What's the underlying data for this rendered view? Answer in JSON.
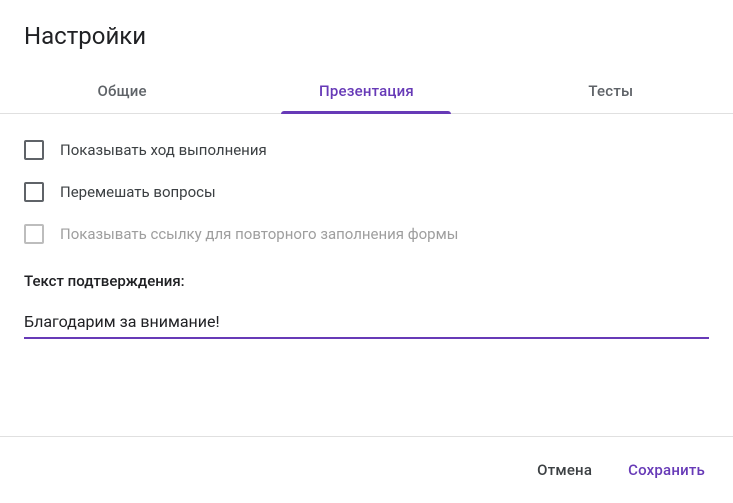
{
  "header": {
    "title": "Настройки"
  },
  "tabs": {
    "general": "Общие",
    "presentation": "Презентация",
    "quizzes": "Тесты"
  },
  "options": {
    "show_progress": "Показывать ход выполнения",
    "shuffle_questions": "Перемешать вопросы",
    "show_resubmit_link": "Показывать ссылку для повторного заполнения формы"
  },
  "confirmation": {
    "label": "Текст подтверждения:",
    "value": "Благодарим за внимание!"
  },
  "footer": {
    "cancel": "Отмена",
    "save": "Сохранить"
  }
}
